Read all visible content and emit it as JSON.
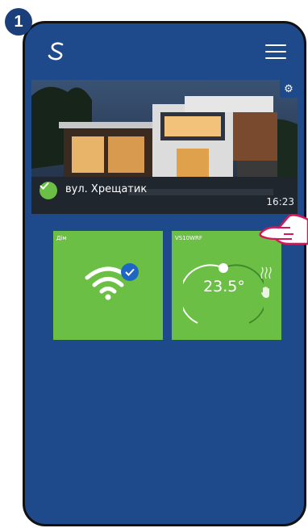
{
  "step": {
    "number": "1"
  },
  "home": {
    "name": "вул. Хрещатик",
    "time": "16:23"
  },
  "tiles": [
    {
      "label": "Дім",
      "icon": "wifi-icon",
      "status": "connected"
    },
    {
      "label": "VS10WRF",
      "temperature": "23.5°",
      "icons": [
        "heating-icon",
        "manual-hand-icon"
      ]
    }
  ],
  "colors": {
    "background": "#1e4a8b",
    "tile": "#6cbf45",
    "badge": "#1b3f7a",
    "check_blue": "#1e66c5"
  }
}
